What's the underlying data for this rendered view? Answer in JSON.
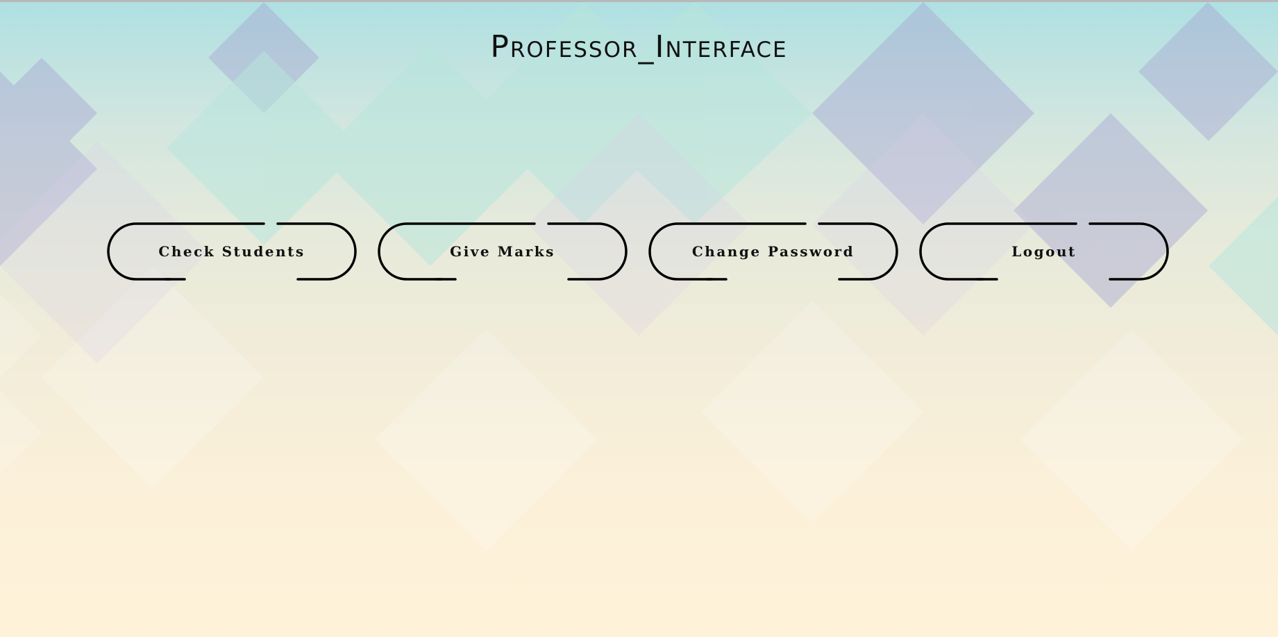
{
  "page": {
    "title": "Professor_Interface"
  },
  "buttons": [
    {
      "label": "Check Students"
    },
    {
      "label": "Give Marks"
    },
    {
      "label": "Change Password"
    },
    {
      "label": "Logout"
    }
  ],
  "colors": {
    "background_top": "#aee0e2",
    "background_bottom": "#fff2d9",
    "pattern_violet": "#a7a7d3",
    "pattern_mint": "#b8e6dc",
    "text": "#111111",
    "button_outline": "#000000"
  }
}
